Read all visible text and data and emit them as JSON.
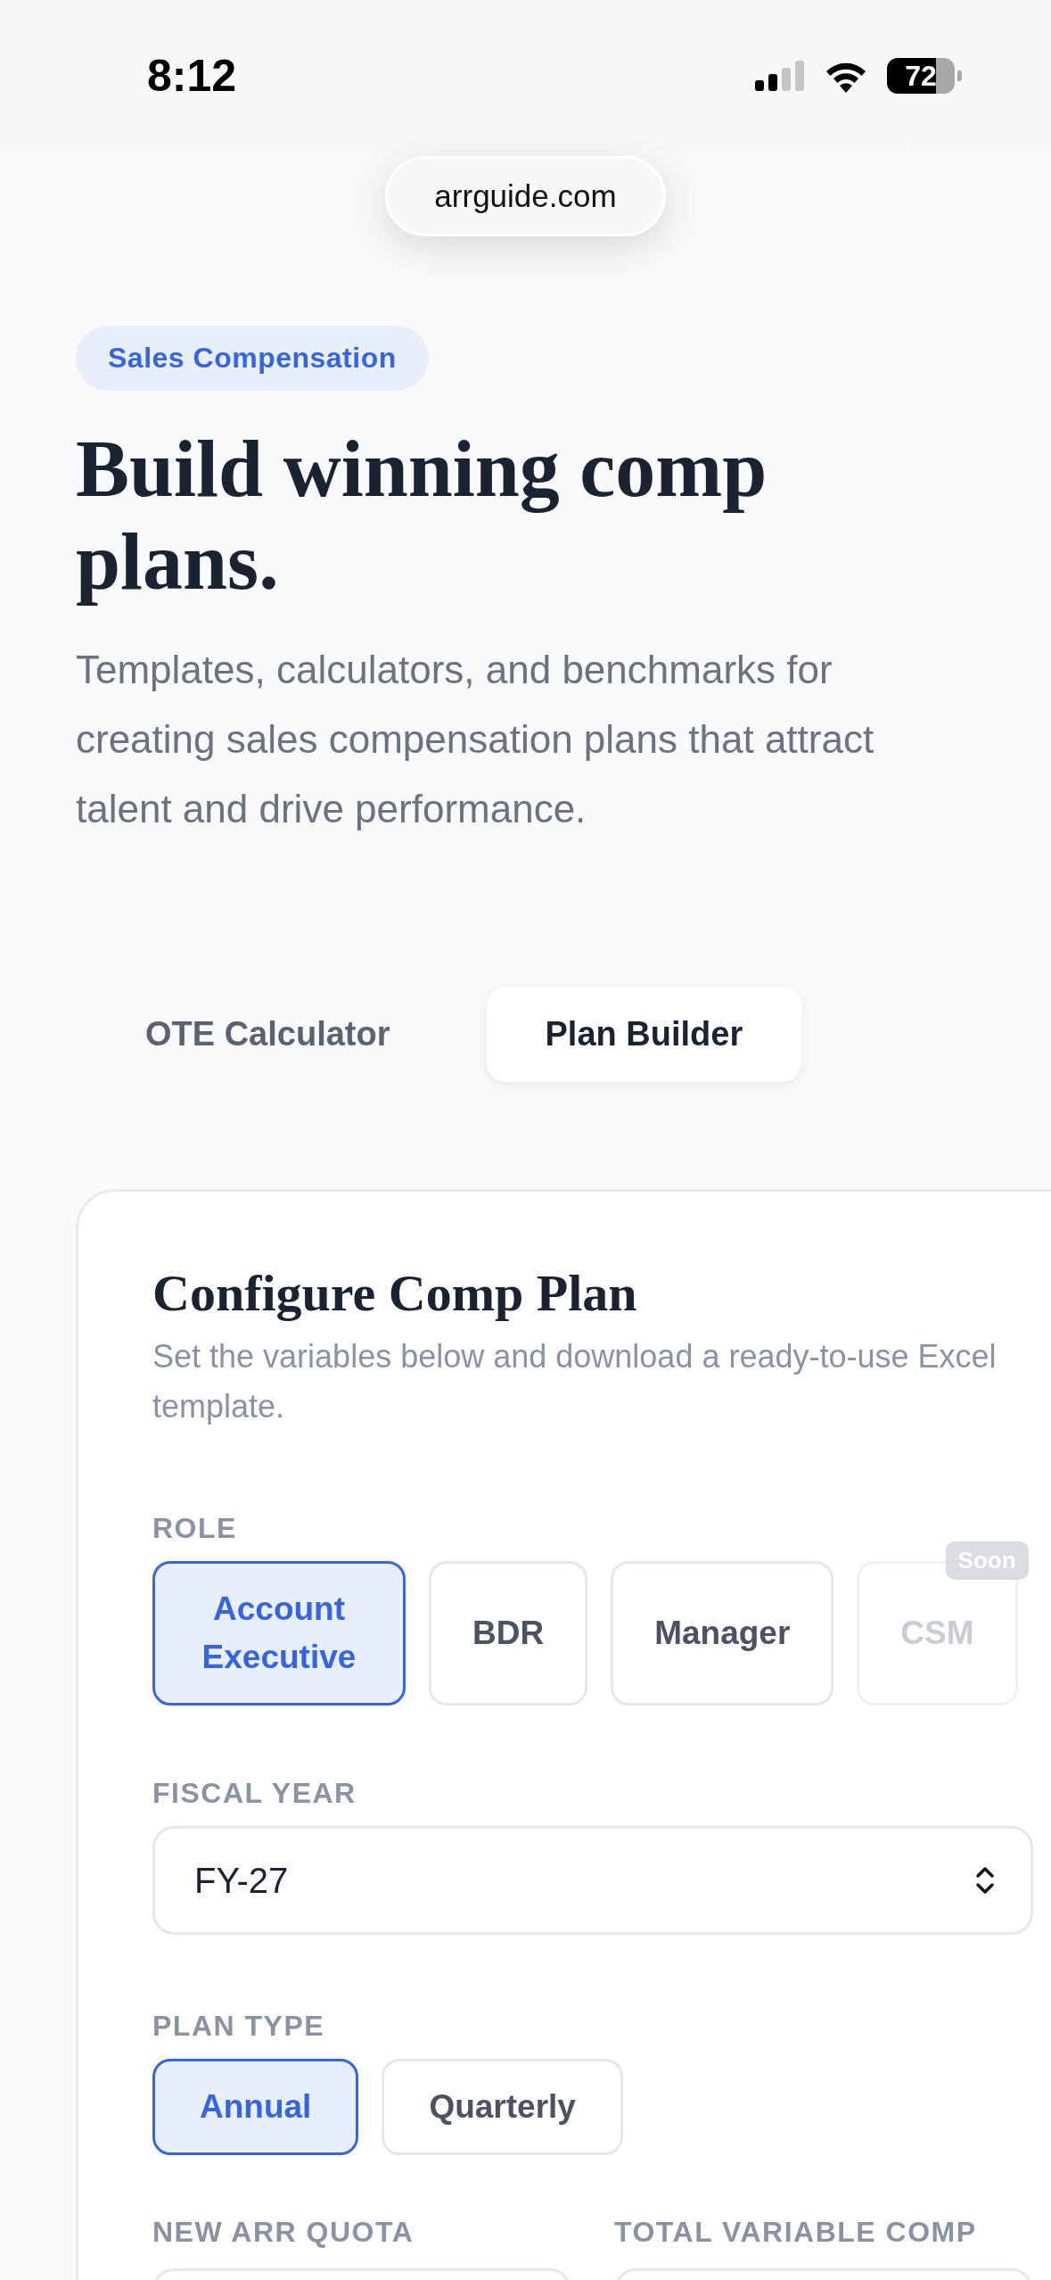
{
  "status_bar": {
    "time": "8:12",
    "battery": "72"
  },
  "browser": {
    "url": "arrguide.com"
  },
  "hero": {
    "badge": "Sales Compensation",
    "title": "Build winning comp plans.",
    "description": "Templates, calculators, and benchmarks for creating sales compensation plans that attract talent and drive performance."
  },
  "tabs": [
    {
      "label": "OTE Calculator",
      "selected": false
    },
    {
      "label": "Plan Builder",
      "selected": true
    }
  ],
  "card": {
    "title": "Configure Comp Plan",
    "subtitle": "Set the variables below and download a ready-to-use Excel template.",
    "role": {
      "label": "ROLE",
      "options": [
        {
          "label": "Account Executive",
          "selected": true,
          "disabled": false
        },
        {
          "label": "BDR",
          "selected": false,
          "disabled": false
        },
        {
          "label": "Manager",
          "selected": false,
          "disabled": false
        },
        {
          "label": "CSM",
          "selected": false,
          "disabled": true,
          "badge": "Soon"
        }
      ]
    },
    "fiscal_year": {
      "label": "FISCAL YEAR",
      "value": "FY-27"
    },
    "plan_type": {
      "label": "PLAN TYPE",
      "options": [
        {
          "label": "Annual",
          "selected": true
        },
        {
          "label": "Quarterly",
          "selected": false
        }
      ]
    },
    "fields": [
      {
        "label": "NEW ARR QUOTA"
      },
      {
        "label": "TOTAL VARIABLE COMP"
      }
    ]
  }
}
